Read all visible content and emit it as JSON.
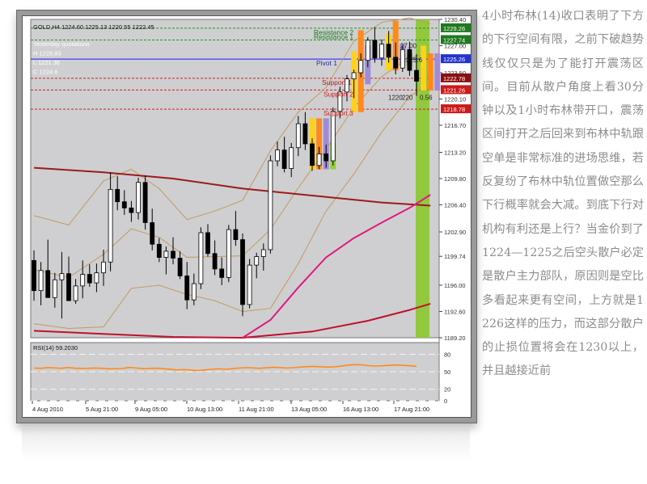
{
  "chart_data": {
    "type": "candlestick",
    "symbol_header": "GOLD,H4  1224.60  1225.13  1220.55  1222.45",
    "info_lines": [
      "Yesterday quotations",
      "H 1228.83",
      "L 1221.36",
      "C 1224.6"
    ],
    "y_ticks": [
      1189.2,
      1192.6,
      1196.0,
      1199.74,
      1202.9,
      1206.4,
      1209.8,
      1213.2,
      1216.7,
      1220.1,
      1223.5,
      1227.0,
      1230.4
    ],
    "price_labels": [
      {
        "value": 1229.26,
        "bg": "#1f7a1f"
      },
      {
        "value": 1227.74,
        "bg": "#1f7a1f"
      },
      {
        "value": 1225.26,
        "bg": "#2233cc"
      },
      {
        "value": 1222.78,
        "bg": "#8a1010"
      },
      {
        "value": 1221.26,
        "bg": "#cc1a1a"
      },
      {
        "value": 1218.78,
        "bg": "#cc1a1a"
      }
    ],
    "level_lines": [
      {
        "name": "Resistance 2",
        "value": 1229.26,
        "color": "#1f9a1f"
      },
      {
        "name": "Resistance 1",
        "value": 1227.74,
        "color": "#1f9a1f"
      },
      {
        "name": "Pivot",
        "value": 1225.26,
        "color": "#1a1aff"
      },
      {
        "name": "Support 1",
        "value": 1222.78,
        "color": "#cc2020"
      },
      {
        "name": "Support 2",
        "value": 1221.26,
        "color": "#cc2020"
      },
      {
        "name": "Support 3",
        "value": 1218.78,
        "color": "#cc2020"
      }
    ],
    "level_texts": [
      "Resistance 2",
      "Resistance 1",
      "Pivot 1",
      "Support 1",
      "Support 2",
      "Support 3"
    ],
    "small_labels": [
      "27.00",
      "225.6",
      "1220",
      "220",
      "0.56"
    ],
    "x_labels": [
      "4 Aug 2010",
      "5 Aug 21:00",
      "9 Aug 05:00",
      "10 Aug 13:00",
      "11 Aug 21:00",
      "13 Aug 05:00",
      "16 Aug 13:00",
      "17 Aug 21:00"
    ],
    "rsi_label": "RSI(14) 59.2030",
    "rsi_ticks": [
      80,
      50,
      20,
      0
    ],
    "rsi_values": [
      56.2,
      55.8,
      57.1,
      56.5,
      55.9,
      57.2,
      56.0,
      55.4,
      55.8,
      56.3,
      55.9,
      55.0,
      55.3,
      55.6,
      57.4,
      56.2,
      55.1,
      55.7,
      56.0,
      55.2,
      54.0,
      53.1,
      53.7,
      52.6,
      51.9,
      53.0,
      54.1,
      54.9,
      54.2,
      55.1,
      56.3,
      57.0,
      56.5,
      55.8,
      56.6,
      57.5,
      57.1,
      56.2,
      57.0,
      57.9,
      58.8,
      59.2,
      58.5,
      57.9,
      58.3,
      59.6,
      61.2,
      62.1,
      61.8,
      60.4,
      59.7,
      60.2,
      61.0,
      61.5,
      60.8,
      60.3,
      59.2
    ],
    "candles": [
      [
        1199.2,
        1200.5,
        1194.0,
        1195.3
      ],
      [
        1195.3,
        1199.0,
        1193.4,
        1197.9
      ],
      [
        1197.9,
        1201.9,
        1196.2,
        1194.4
      ],
      [
        1194.4,
        1197.6,
        1193.1,
        1196.7
      ],
      [
        1196.7,
        1200.3,
        1191.7,
        1197.5
      ],
      [
        1197.5,
        1199.7,
        1194.2,
        1194.0
      ],
      [
        1194.0,
        1196.8,
        1193.6,
        1195.9
      ],
      [
        1195.9,
        1199.2,
        1194.3,
        1197.4
      ],
      [
        1197.4,
        1198.7,
        1195.8,
        1196.3
      ],
      [
        1196.3,
        1198.8,
        1195.1,
        1197.6
      ],
      [
        1197.6,
        1200.6,
        1195.9,
        1199.0
      ],
      [
        1199.0,
        1210.6,
        1197.8,
        1208.4
      ],
      [
        1208.4,
        1210.1,
        1205.7,
        1206.8
      ],
      [
        1206.8,
        1208.3,
        1205.1,
        1206.0
      ],
      [
        1206.0,
        1206.9,
        1204.2,
        1205.4
      ],
      [
        1205.4,
        1209.9,
        1204.5,
        1209.3
      ],
      [
        1209.3,
        1210.2,
        1203.2,
        1204.1
      ],
      [
        1204.1,
        1205.9,
        1200.5,
        1201.3
      ],
      [
        1201.3,
        1202.1,
        1199.0,
        1199.6
      ],
      [
        1199.6,
        1201.0,
        1197.4,
        1200.4
      ],
      [
        1200.4,
        1202.2,
        1198.7,
        1199.5
      ],
      [
        1199.5,
        1200.4,
        1196.8,
        1197.2
      ],
      [
        1197.2,
        1199.0,
        1192.9,
        1194.1
      ],
      [
        1194.1,
        1197.5,
        1193.4,
        1196.2
      ],
      [
        1196.2,
        1203.5,
        1195.5,
        1202.8
      ],
      [
        1202.8,
        1203.9,
        1199.7,
        1200.1
      ],
      [
        1200.1,
        1201.8,
        1197.3,
        1198.1
      ],
      [
        1198.1,
        1199.6,
        1196.0,
        1197.0
      ],
      [
        1197.0,
        1203.8,
        1196.4,
        1203.2
      ],
      [
        1203.2,
        1205.6,
        1201.1,
        1201.9
      ],
      [
        1201.9,
        1202.7,
        1192.0,
        1193.5
      ],
      [
        1193.5,
        1199.4,
        1193.0,
        1198.6
      ],
      [
        1198.6,
        1200.2,
        1196.9,
        1199.7
      ],
      [
        1199.7,
        1201.4,
        1197.9,
        1200.6
      ],
      [
        1200.6,
        1212.8,
        1200.1,
        1212.1
      ],
      [
        1212.1,
        1214.6,
        1211.4,
        1213.5
      ],
      [
        1213.5,
        1215.2,
        1210.6,
        1211.1
      ],
      [
        1211.1,
        1214.4,
        1210.0,
        1213.8
      ],
      [
        1213.8,
        1217.9,
        1212.7,
        1216.9
      ],
      [
        1216.9,
        1218.4,
        1213.5,
        1214.3
      ],
      [
        1214.3,
        1215.0,
        1210.8,
        1211.5
      ],
      [
        1211.5,
        1213.9,
        1211.0,
        1213.0
      ],
      [
        1213.0,
        1214.2,
        1211.2,
        1212.1
      ],
      [
        1212.1,
        1219.0,
        1211.5,
        1218.5
      ],
      [
        1218.5,
        1221.7,
        1217.6,
        1221.0
      ],
      [
        1221.0,
        1223.2,
        1219.8,
        1222.7
      ],
      [
        1222.7,
        1223.9,
        1220.2,
        1223.5
      ],
      [
        1223.5,
        1226.0,
        1222.9,
        1225.1
      ],
      [
        1225.1,
        1228.1,
        1224.2,
        1227.7
      ],
      [
        1227.7,
        1229.4,
        1224.8,
        1225.4
      ],
      [
        1225.4,
        1227.8,
        1224.4,
        1227.2
      ],
      [
        1227.2,
        1228.9,
        1224.8,
        1225.5
      ],
      [
        1225.5,
        1227.4,
        1223.3,
        1224.1
      ],
      [
        1224.1,
        1227.0,
        1223.6,
        1226.5
      ],
      [
        1226.5,
        1227.5,
        1223.1,
        1223.8
      ],
      [
        1223.8,
        1225.9,
        1220.5,
        1222.4
      ]
    ],
    "colored_bars": [
      {
        "index": 40,
        "top": 1217.6,
        "bottom": 1211.0,
        "color": "#ffd21a"
      },
      {
        "index": 41,
        "top": 1217.6,
        "bottom": 1211.0,
        "color": "#ff8a1a"
      },
      {
        "index": 42,
        "top": 1217.6,
        "bottom": 1211.0,
        "color": "#a08bd6"
      },
      {
        "index": 43,
        "top": 1214.4,
        "bottom": 1211.0,
        "color": "#8fcf3a"
      },
      {
        "index": 46,
        "top": 1226.3,
        "bottom": 1218.4,
        "color": "#ffd21a"
      },
      {
        "index": 47,
        "top": 1229.0,
        "bottom": 1218.4,
        "color": "#ff8a1a"
      },
      {
        "index": 48,
        "top": 1227.0,
        "bottom": 1222.0,
        "color": "#a08bd6"
      },
      {
        "index": 51,
        "top": 1228.5,
        "bottom": 1223.8,
        "color": "#ffd21a"
      },
      {
        "index": 52,
        "top": 1230.2,
        "bottom": 1223.8,
        "color": "#ff8a1a"
      },
      {
        "index": 53,
        "top": 1227.2,
        "bottom": 1224.4,
        "color": "#a08bd6"
      },
      {
        "index": 54,
        "top": 1226.0,
        "bottom": 1224.4,
        "color": "#8fcf3a"
      },
      {
        "index": 56,
        "top": 1227.0,
        "bottom": 1221.2,
        "color": "#ffd21a"
      },
      {
        "index": 57,
        "top": 1226.0,
        "bottom": 1221.2,
        "color": "#ff8a1a"
      },
      {
        "index": 58,
        "top": 1226.0,
        "bottom": 1221.2,
        "color": "#a08bd6"
      }
    ],
    "green_column": {
      "top": 1230.4,
      "bottom": 1189.2,
      "color": "#92c83e"
    },
    "ma_slow": {
      "color": "#9b1c1c",
      "points": [
        [
          0,
          1211.2
        ],
        [
          10,
          1210.6
        ],
        [
          20,
          1209.8
        ],
        [
          30,
          1208.5
        ],
        [
          40,
          1207.6
        ],
        [
          50,
          1206.7
        ],
        [
          57,
          1206.3
        ]
      ]
    },
    "ma_fast": {
      "color": "#e0197e",
      "points": [
        [
          30,
          1189.2
        ],
        [
          34,
          1191.5
        ],
        [
          38,
          1195.7
        ],
        [
          42,
          1199.6
        ],
        [
          46,
          1202.1
        ],
        [
          50,
          1204.1
        ],
        [
          54,
          1206.0
        ],
        [
          57,
          1207.7
        ]
      ]
    },
    "ma_long": {
      "color": "#c0122d",
      "points": [
        [
          0,
          1190.1
        ],
        [
          10,
          1189.7
        ],
        [
          20,
          1189.3
        ],
        [
          30,
          1189.2
        ],
        [
          40,
          1190.0
        ],
        [
          48,
          1191.4
        ],
        [
          54,
          1192.8
        ],
        [
          57,
          1193.6
        ]
      ]
    },
    "bb_upper": {
      "color": "#c09a60",
      "points": [
        [
          0,
          1205.0
        ],
        [
          5,
          1203.8
        ],
        [
          10,
          1209.5
        ],
        [
          14,
          1211.0
        ],
        [
          18,
          1208.5
        ],
        [
          22,
          1204.5
        ],
        [
          26,
          1205.6
        ],
        [
          30,
          1207.0
        ],
        [
          34,
          1213.4
        ],
        [
          38,
          1218.4
        ],
        [
          42,
          1221.6
        ],
        [
          46,
          1227.6
        ],
        [
          50,
          1230.0
        ],
        [
          54,
          1230.6
        ],
        [
          57,
          1229.8
        ]
      ]
    },
    "bb_mid": {
      "color": "#c09a60",
      "points": [
        [
          0,
          1198.0
        ],
        [
          5,
          1197.0
        ],
        [
          10,
          1200.0
        ],
        [
          14,
          1203.3
        ],
        [
          18,
          1202.2
        ],
        [
          22,
          1199.6
        ],
        [
          26,
          1199.7
        ],
        [
          30,
          1199.8
        ],
        [
          34,
          1203.2
        ],
        [
          38,
          1208.6
        ],
        [
          42,
          1213.6
        ],
        [
          46,
          1219.0
        ],
        [
          50,
          1223.0
        ],
        [
          54,
          1225.5
        ],
        [
          57,
          1226.0
        ]
      ]
    },
    "bb_lower": {
      "color": "#c09a60",
      "points": [
        [
          0,
          1191.0
        ],
        [
          5,
          1190.4
        ],
        [
          10,
          1190.6
        ],
        [
          14,
          1195.6
        ],
        [
          18,
          1196.0
        ],
        [
          22,
          1194.8
        ],
        [
          26,
          1194.0
        ],
        [
          30,
          1192.6
        ],
        [
          34,
          1193.0
        ],
        [
          38,
          1198.8
        ],
        [
          42,
          1205.6
        ],
        [
          46,
          1210.4
        ],
        [
          50,
          1215.8
        ],
        [
          54,
          1220.4
        ],
        [
          57,
          1222.2
        ]
      ]
    }
  },
  "article": {
    "text": "4小时布林(14)收口表明了下方的下行空间有限，之前下破趋势线仅仅只是为了能打开震荡区间。目前从散户角度上看30分钟以及1小时布林带开口，震荡区间打开之后回来到布林中轨跟空单是非常标准的进场思维，若反复纷了布林中轨位置做空那么下行概率就会大减。到底下行对机构有利还是上行？当金价到了1224—1225之后空头散户必定是散户主力部队，原因则是空比多看起来更有空间，上方就是1226这样的压力，而这部分散户的止损位置将会在1230以上，并且越接近前"
  }
}
